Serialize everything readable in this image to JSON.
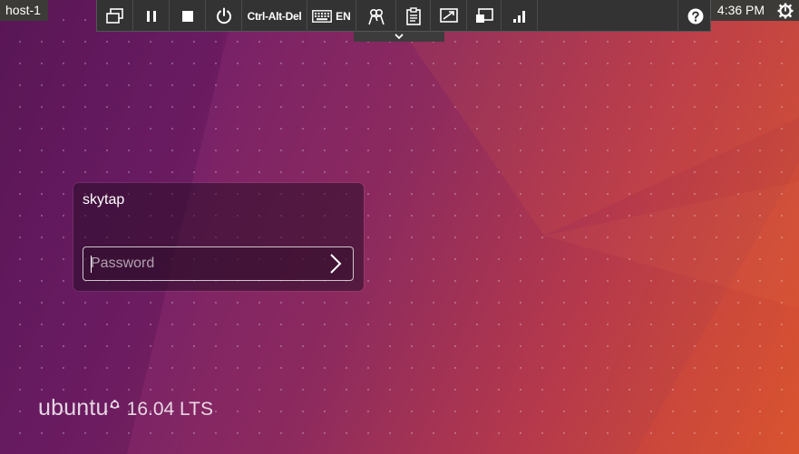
{
  "host": {
    "label": "host-1"
  },
  "toolbar": {
    "buttons": [
      {
        "name": "switch-display-icon",
        "label": ""
      },
      {
        "name": "pause-icon",
        "label": ""
      },
      {
        "name": "stop-icon",
        "label": ""
      },
      {
        "name": "power-icon",
        "label": ""
      },
      {
        "name": "ctrl-alt-del",
        "label": "Ctrl-Alt-Del"
      },
      {
        "name": "keyboard-icon",
        "label": "EN"
      },
      {
        "name": "shared-access-icon",
        "label": ""
      },
      {
        "name": "clipboard-icon",
        "label": ""
      },
      {
        "name": "fit-screen-icon",
        "label": ""
      },
      {
        "name": "window-icon",
        "label": ""
      },
      {
        "name": "signal-icon",
        "label": ""
      },
      {
        "name": "help-icon",
        "label": ""
      }
    ],
    "ctrl_alt_del_label": "Ctrl-Alt-Del",
    "keyboard_lang": "EN"
  },
  "panel": {
    "clock": "4:36 PM",
    "power_icon": "gear-power-icon"
  },
  "login": {
    "username": "skytap",
    "password_placeholder": "Password",
    "password_value": ""
  },
  "branding": {
    "os_name": "ubuntu",
    "version": "16.04 LTS"
  },
  "colors": {
    "panel": "#3c3b37",
    "toolbar": "#333333",
    "wallpaper_start": "#5e1a5a",
    "wallpaper_end": "#d4532e"
  }
}
